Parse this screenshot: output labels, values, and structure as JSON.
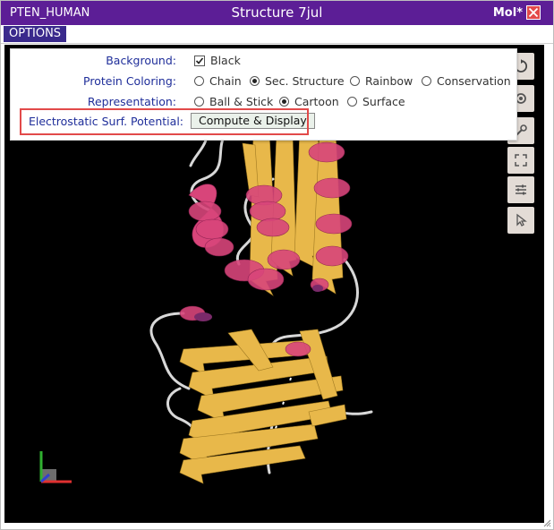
{
  "titlebar": {
    "protein_id": "PTEN_HUMAN",
    "structure_title": "Structure 7jul",
    "viewer_name": "Mol*"
  },
  "menubar": {
    "options_label": "OPTIONS"
  },
  "options": {
    "background_label": "Background:",
    "background_option": "Black",
    "background_checked": true,
    "coloring_label": "Protein Coloring:",
    "coloring_options": [
      "Chain",
      "Sec. Structure",
      "Rainbow",
      "Conservation"
    ],
    "coloring_selected": "Sec. Structure",
    "representation_label": "Representation:",
    "representation_options": [
      "Ball & Stick",
      "Cartoon",
      "Surface"
    ],
    "representation_selected": "Cartoon",
    "electrostatic_label": "Electrostatic Surf. Potential:",
    "compute_button": "Compute & Display"
  },
  "colors": {
    "titlebar": "#5c1e96",
    "options_button": "#3a2a8c",
    "label_text": "#1f2e9a",
    "highlight_border": "#e24a4a",
    "helix": "#d8457a",
    "sheet": "#e8b84a",
    "coil": "#d8d8d8",
    "viewer_background": "#000000"
  },
  "toolbar_icons": [
    "reset-view-icon",
    "settings-icon",
    "wrench-icon",
    "fullscreen-icon",
    "sliders-icon",
    "select-arrow-icon"
  ]
}
